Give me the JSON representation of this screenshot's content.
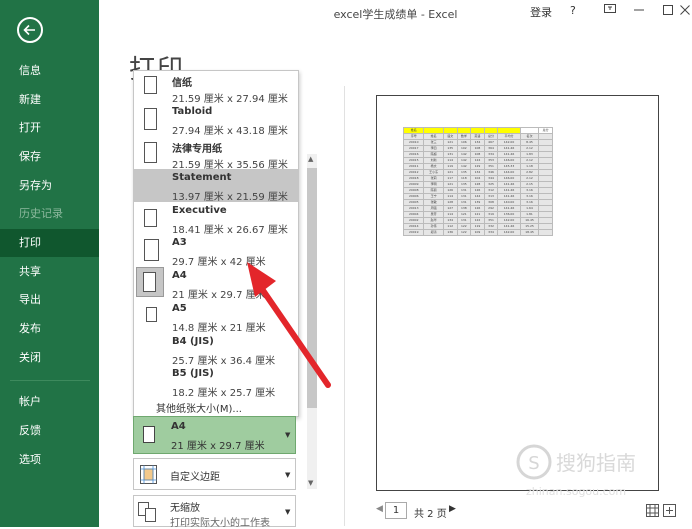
{
  "window": {
    "title": "excel学生成绩单 - Excel",
    "login": "登录",
    "help": "?"
  },
  "sidebar": {
    "items": [
      {
        "label": "信息"
      },
      {
        "label": "新建"
      },
      {
        "label": "打开"
      },
      {
        "label": "保存"
      },
      {
        "label": "另存为"
      },
      {
        "label": "历史记录"
      },
      {
        "label": "打印"
      },
      {
        "label": "共享"
      },
      {
        "label": "导出"
      },
      {
        "label": "发布"
      },
      {
        "label": "关闭"
      },
      {
        "label": "帐户"
      },
      {
        "label": "反馈"
      },
      {
        "label": "选项"
      }
    ]
  },
  "page_title": "打印",
  "paper_menu": {
    "items": [
      {
        "name": "信纸",
        "size": "21.59 厘米 x 27.94 厘米"
      },
      {
        "name": "Tabloid",
        "size": "27.94 厘米 x 43.18 厘米"
      },
      {
        "name": "法律专用纸",
        "size": "21.59 厘米 x 35.56 厘米"
      },
      {
        "name": "Statement",
        "size": "13.97 厘米 x 21.59 厘米"
      },
      {
        "name": "Executive",
        "size": "18.41 厘米 x 26.67 厘米"
      },
      {
        "name": "A3",
        "size": "29.7 厘米 x 42 厘米"
      },
      {
        "name": "A4",
        "size": "21 厘米 x 29.7 厘米"
      },
      {
        "name": "A5",
        "size": "14.8 厘米 x 21 厘米"
      },
      {
        "name": "B4 (JIS)",
        "size": "25.7 厘米 x 36.4 厘米"
      },
      {
        "name": "B5 (JIS)",
        "size": "18.2 厘米 x 25.7 厘米"
      }
    ],
    "other": "其他纸张大小(M)..."
  },
  "current_paper": {
    "name": "A4",
    "size": "21 厘米 x 29.7 厘米"
  },
  "margins": {
    "label": "自定义边距"
  },
  "scaling": {
    "label": "无缩放",
    "sub": "打印实际大小的工作表"
  },
  "pager": {
    "current": "1",
    "total": "共 2 页"
  },
  "colors": {
    "sidebar": "#217346",
    "selected": "#c6c6c6",
    "current": "#9fcc9f",
    "arrow": "#e3262b"
  },
  "preview": {
    "header_cells": [
      "姓名",
      "",
      "",
      "",
      "",
      "",
      "",
      "",
      "总分"
    ],
    "rows": [
      [
        "序号",
        "姓名",
        "语文",
        "数学",
        "英语",
        "总分",
        "平均分",
        "名次"
      ],
      [
        "20010",
        "张三",
        "121",
        "106",
        "134",
        "467",
        "142.00",
        "8.45"
      ],
      [
        "20017",
        "李四",
        "135",
        "102",
        "108",
        "364",
        "141.46",
        "2.12"
      ],
      [
        "20016",
        "陈超",
        "131",
        "142",
        "108",
        "334",
        "141.46",
        "1.83"
      ],
      [
        "20015",
        "刘新",
        "114",
        "142",
        "124",
        "353",
        "146.00",
        "2.12"
      ],
      [
        "20011",
        "杨文",
        "119",
        "142",
        "129",
        "351",
        "145.33",
        "1.18"
      ],
      [
        "20012",
        "王小东",
        "121",
        "135",
        "134",
        "346",
        "144.00",
        "2.82"
      ],
      [
        "20018",
        "张莉",
        "117",
        "118",
        "104",
        "344",
        "146.00",
        "2.12"
      ],
      [
        "20009",
        "李明",
        "121",
        "135",
        "128",
        "325",
        "141.46",
        "2.15"
      ],
      [
        "20008",
        "陈丽",
        "126",
        "131",
        "126",
        "312",
        "141.46",
        "3.16"
      ],
      [
        "20006",
        "王宁",
        "114",
        "131",
        "144",
        "313",
        "141.46",
        "3.16"
      ],
      [
        "20005",
        "张敏",
        "128",
        "131",
        "139",
        "308",
        "140.00",
        "3.16"
      ],
      [
        "20013",
        "周强",
        "127",
        "138",
        "126",
        "292",
        "141.46",
        "1.64"
      ],
      [
        "20004",
        "吴芳",
        "114",
        "121",
        "121",
        "319",
        "136.00",
        "1.81"
      ],
      [
        "20002",
        "赵华",
        "134",
        "131",
        "122",
        "351",
        "142.00",
        "16.45"
      ],
      [
        "20014",
        "孙伟",
        "112",
        "122",
        "119",
        "332",
        "141.46",
        "15.25"
      ],
      [
        "20019",
        "郑涛",
        "136",
        "122",
        "109",
        "334",
        "142.00",
        "18.45"
      ]
    ]
  }
}
